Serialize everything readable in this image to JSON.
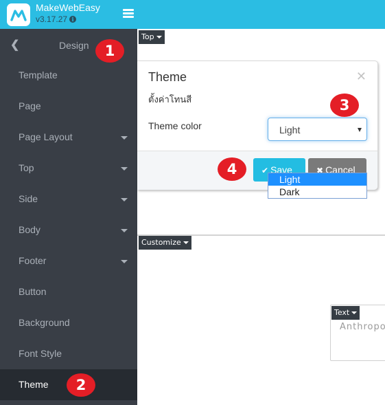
{
  "app": {
    "name": "MakeWebEasy",
    "version": "v3.17.27",
    "info_icon": "info-circle-icon",
    "menu_icon": "hamburger-icon",
    "brand_color": "#2bbde3"
  },
  "sidebar": {
    "back_icon": "chevron-left-icon",
    "title": "Design",
    "items": [
      {
        "label": "Template",
        "has_caret": false,
        "active": false
      },
      {
        "label": "Page",
        "has_caret": false,
        "active": false
      },
      {
        "label": "Page Layout",
        "has_caret": true,
        "active": false
      },
      {
        "label": "Top",
        "has_caret": true,
        "active": false
      },
      {
        "label": "Side",
        "has_caret": true,
        "active": false
      },
      {
        "label": "Body",
        "has_caret": true,
        "active": false
      },
      {
        "label": "Footer",
        "has_caret": true,
        "active": false
      },
      {
        "label": "Button",
        "has_caret": false,
        "active": false
      },
      {
        "label": "Background",
        "has_caret": false,
        "active": false
      },
      {
        "label": "Font Style",
        "has_caret": false,
        "active": false
      },
      {
        "label": "Theme",
        "has_caret": false,
        "active": true
      }
    ]
  },
  "canvas": {
    "top_tag": "Top",
    "customize_tag": "Customize",
    "text_tag": "Text",
    "text_preview": "Anthropol"
  },
  "modal": {
    "title": "Theme",
    "close_icon": "close-icon",
    "subtitle": "ตั้งค่าโทนสี",
    "field_label": "Theme color",
    "select_value": "Light",
    "options": [
      "Light",
      "Dark"
    ],
    "selected_option": "Light",
    "save_label": "Save",
    "save_icon": "check-icon",
    "cancel_label": "Cancel",
    "cancel_icon": "times-icon",
    "save_color": "#23bde2",
    "cancel_color": "#7a7a7a"
  },
  "callouts": [
    "1",
    "2",
    "3",
    "4"
  ],
  "callout_color": "#e41e26"
}
